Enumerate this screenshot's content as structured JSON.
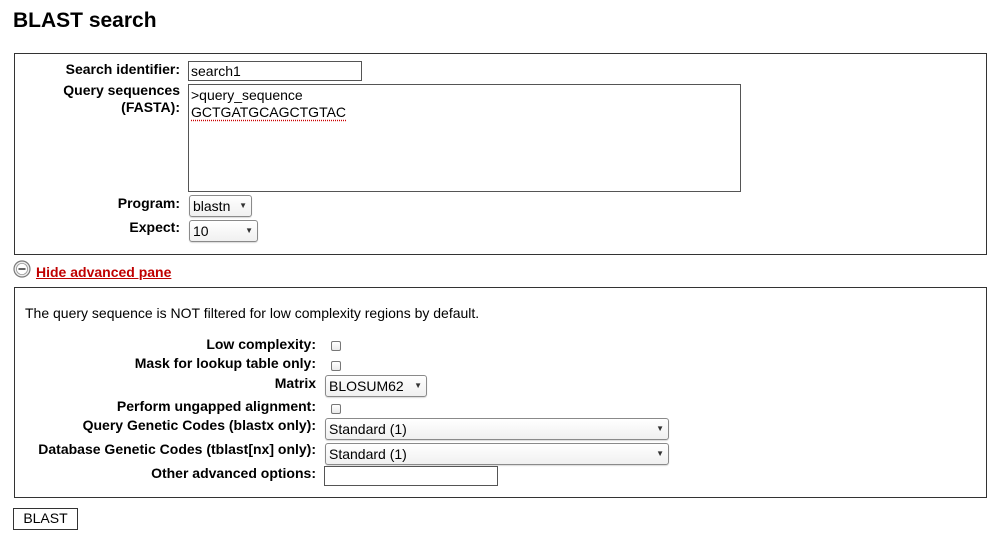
{
  "page": {
    "title": "BLAST search"
  },
  "form": {
    "search_identifier": {
      "label": "Search identifier:",
      "value": "search1"
    },
    "query_sequences": {
      "label_line1": "Query sequences",
      "label_line2": "(FASTA):",
      "line1": ">query_sequence",
      "line2": "GCTGATGCAGCTGTAC"
    },
    "program": {
      "label": "Program:",
      "value": "blastn"
    },
    "expect": {
      "label": "Expect:",
      "value": "10"
    }
  },
  "advanced_toggle": {
    "label": "Hide advanced pane",
    "icon": "minus-circle-icon"
  },
  "advanced": {
    "note": "The query sequence is NOT filtered for low complexity regions by default.",
    "low_complexity": {
      "label": "Low complexity:",
      "checked": false
    },
    "mask_lookup": {
      "label": "Mask for lookup table only:",
      "checked": false
    },
    "matrix": {
      "label": "Matrix",
      "value": "BLOSUM62"
    },
    "ungapped": {
      "label": "Perform ungapped alignment:",
      "checked": false
    },
    "query_genetic_codes": {
      "label": "Query Genetic Codes (blastx only):",
      "value": "Standard (1)"
    },
    "db_genetic_codes": {
      "label": "Database Genetic Codes (tblast[nx] only):",
      "value": "Standard (1)"
    },
    "other_options": {
      "label": "Other advanced options:",
      "value": ""
    }
  },
  "submit": {
    "label": "BLAST"
  }
}
